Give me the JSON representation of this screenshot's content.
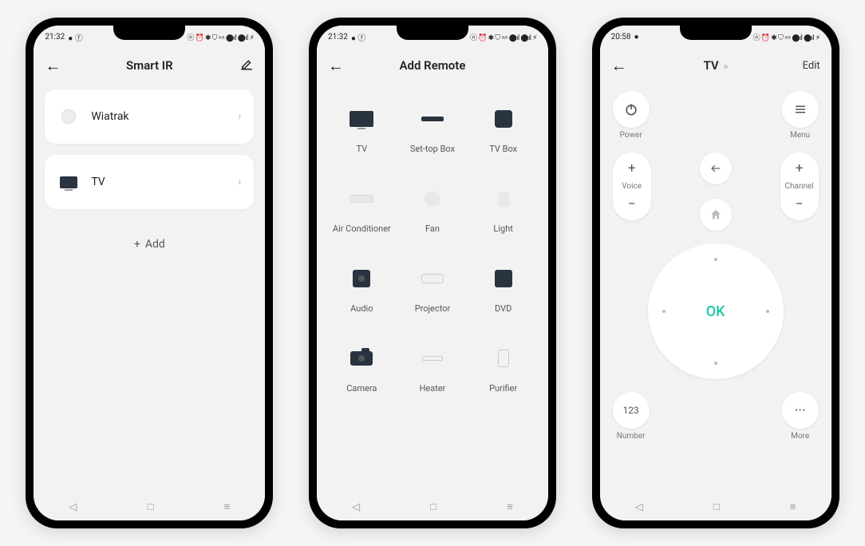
{
  "status": {
    "time1": "21:32",
    "time2": "21:32",
    "time3": "20:58",
    "icons_left": "● ⓕ",
    "icons_left3": "●",
    "icons_right": "ⓝ ⏰ ✱ ⛉ 𝌂 ⬤ıl ⬤ıl  ⚡︎"
  },
  "phone1": {
    "title": "Smart IR",
    "devices": [
      {
        "name": "Wiatrak",
        "icon": "fan"
      },
      {
        "name": "TV",
        "icon": "tv"
      }
    ],
    "add_label": "Add"
  },
  "phone2": {
    "title": "Add Remote",
    "items": [
      {
        "name": "TV",
        "icon": "tv"
      },
      {
        "name": "Set-top Box",
        "icon": "stb"
      },
      {
        "name": "TV Box",
        "icon": "tvbox"
      },
      {
        "name": "Air Conditioner",
        "icon": "ac"
      },
      {
        "name": "Fan",
        "icon": "fan"
      },
      {
        "name": "Light",
        "icon": "light"
      },
      {
        "name": "Audio",
        "icon": "audio"
      },
      {
        "name": "Projector",
        "icon": "proj"
      },
      {
        "name": "DVD",
        "icon": "dvd"
      },
      {
        "name": "Camera",
        "icon": "cam"
      },
      {
        "name": "Heater",
        "icon": "heat"
      },
      {
        "name": "Purifier",
        "icon": "pur"
      }
    ]
  },
  "phone3": {
    "title": "TV",
    "edit": "Edit",
    "power": "Power",
    "menu": "Menu",
    "voice": "Voice",
    "channel": "Channel",
    "ok": "OK",
    "number": "Number",
    "number_btn": "123",
    "more": "More",
    "more_btn": "···"
  }
}
